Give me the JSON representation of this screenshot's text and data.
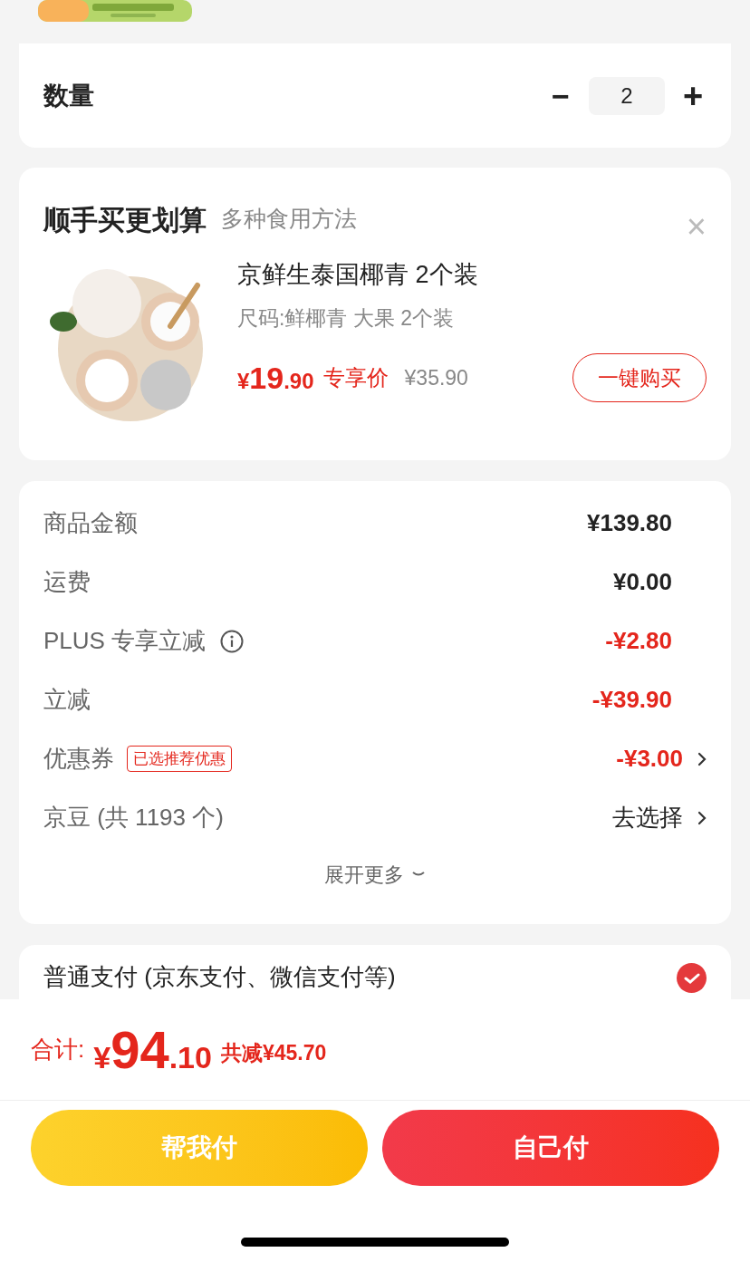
{
  "quantity": {
    "label": "数量",
    "minus": "−",
    "value": "2",
    "plus": "+"
  },
  "addon": {
    "title": "顺手买更划算",
    "subtitle": "多种食用方法",
    "close": "×",
    "product": {
      "name": "京鲜生泰国椰青 2个装",
      "spec": "尺码:鲜椰青 大果 2个装",
      "price_symbol": "¥",
      "price_int": "19",
      "price_dec": ".90",
      "price_tag": "专享价",
      "original_price": "¥35.90",
      "buy_button": "一键购买"
    }
  },
  "summary": {
    "rows": [
      {
        "label": "商品金额",
        "value": "¥139.80",
        "kind": "plain"
      },
      {
        "label": "运费",
        "value": "¥0.00",
        "kind": "plain"
      },
      {
        "label": "PLUS 专享立减",
        "value": "-¥2.80",
        "kind": "info"
      },
      {
        "label": "立减",
        "value": "-¥39.90",
        "kind": "discount"
      },
      {
        "label": "优惠券",
        "value": "-¥3.00",
        "kind": "coupon",
        "tag": "已选推荐优惠"
      },
      {
        "label": "京豆 (共 1193 个)",
        "value": "去选择",
        "kind": "choose"
      }
    ],
    "expand": "展开更多"
  },
  "payment": {
    "label": "普通支付 (京东支付、微信支付等)",
    "selected": true
  },
  "total": {
    "label": "合计:",
    "symbol": "¥",
    "int": "94",
    "dec": ".10",
    "saved": "共减¥45.70"
  },
  "buttons": [
    {
      "label": "帮我付",
      "kind": "secondary"
    },
    {
      "label": "自己付",
      "kind": "primary"
    }
  ]
}
